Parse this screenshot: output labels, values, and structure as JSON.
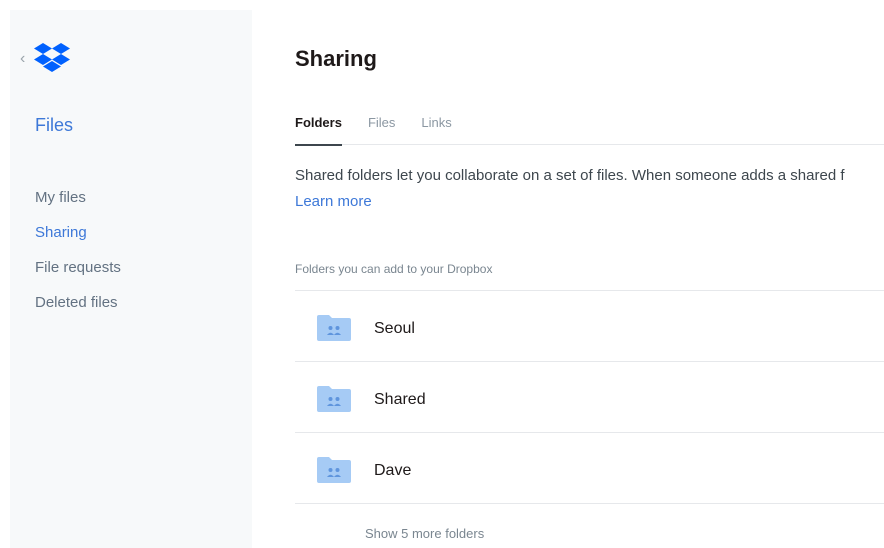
{
  "sidebar": {
    "back_icon": "chevron-left-icon",
    "logo_icon": "dropbox-logo-icon",
    "section_title": "Files",
    "items": [
      {
        "label": "My files"
      },
      {
        "label": "Sharing"
      },
      {
        "label": "File requests"
      },
      {
        "label": "Deleted files"
      }
    ],
    "active_item": "Sharing"
  },
  "main": {
    "title": "Sharing",
    "tabs": [
      {
        "label": "Folders"
      },
      {
        "label": "Files"
      },
      {
        "label": "Links"
      }
    ],
    "active_tab": "Folders",
    "description": "Shared folders let you collaborate on a set of files. When someone adds a shared f",
    "learn_more": "Learn more",
    "folders_caption": "Folders you can add to your Dropbox",
    "folders": [
      {
        "name": "Seoul"
      },
      {
        "name": "Shared"
      },
      {
        "name": "Dave"
      }
    ],
    "folder_icon": "shared-folder-icon",
    "show_more": "Show 5 more folders"
  },
  "colors": {
    "accent": "#3d78d8",
    "sidebar_bg": "#f7f9fa",
    "folder_icon": "#a6cbf5"
  }
}
